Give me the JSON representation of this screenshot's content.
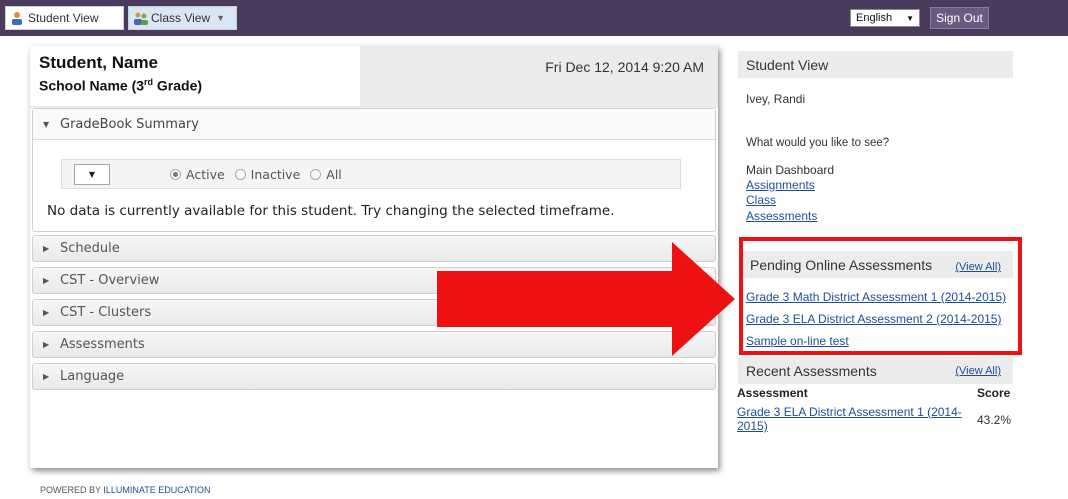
{
  "topbar": {
    "tabs": [
      {
        "label": "Student View",
        "icon": "student-icon"
      },
      {
        "label": "Class View",
        "icon": "class-icon"
      }
    ],
    "language": "English",
    "sign_out": "Sign Out",
    "colors": {
      "bar": "#4a3a5c",
      "button": "#6b5a80"
    }
  },
  "header": {
    "student_name": "Student, Name",
    "school_prefix": "School Name (3",
    "school_sup": "rd",
    "school_suffix": " Grade)",
    "datetime": "Fri Dec 12, 2014 9:20 AM"
  },
  "gradebook": {
    "title": "GradeBook Summary",
    "select_value": "",
    "radios": [
      "Active",
      "Inactive",
      "All"
    ],
    "selected": "Active",
    "message": "No data is currently available for this student. Try changing the selected timeframe."
  },
  "sections": [
    "Schedule",
    "CST - Overview",
    "CST - Clusters",
    "Assessments",
    "Language"
  ],
  "footer": {
    "powered": "POWERED BY ",
    "brand": "ILLUMINATE EDUCATION"
  },
  "sidebar": {
    "title": "Student View",
    "student": "Ivey, Randi",
    "question": "What would you like to see?",
    "current": "Main Dashboard",
    "links": [
      "Assignments",
      "Class",
      "Assessments"
    ],
    "pending": {
      "title": "Pending Online Assessments",
      "view_all": "(View All)",
      "items": [
        "Grade 3 Math District Assessment 1 (2014-2015)",
        "Grade 3 ELA District Assessment 2 (2014-2015)",
        "Sample on-line test"
      ]
    },
    "recent": {
      "title": "Recent Assessments",
      "view_all": "(View All)",
      "col_assessment": "Assessment",
      "col_score": "Score",
      "rows": [
        {
          "name": "Grade 3 ELA District Assessment 1 (2014-2015)",
          "score": "43.2%"
        }
      ]
    }
  },
  "annotation": {
    "color": "#ee1111"
  }
}
